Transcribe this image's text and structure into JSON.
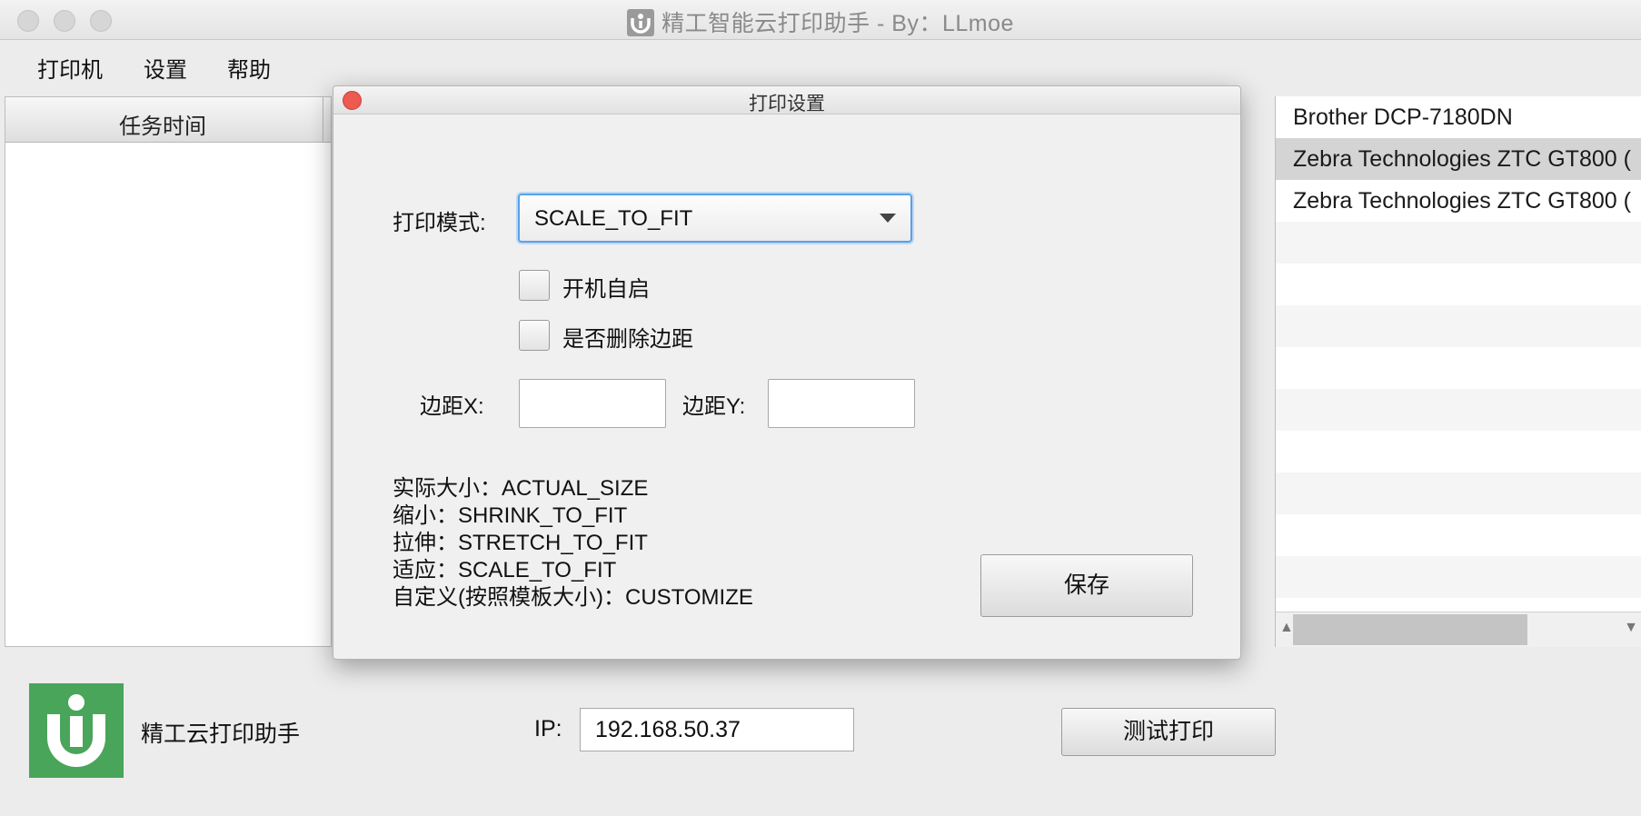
{
  "window": {
    "title": "精工智能云打印助手 - By：LLmoe"
  },
  "menu": {
    "items": [
      "打印机",
      "设置",
      "帮助"
    ]
  },
  "task_table": {
    "columns": [
      "任务时间"
    ]
  },
  "printers": {
    "items": [
      "Brother DCP-7180DN",
      "Zebra Technologies ZTC GT800 (",
      "Zebra Technologies ZTC GT800 ("
    ],
    "selected_index": 1,
    "scroll_arrow_left": "▲",
    "scroll_arrow_right": "▼"
  },
  "bottom": {
    "brand": "精工云打印助手",
    "ip_label": "IP:",
    "ip_value": "192.168.50.37",
    "test_print_label": "测试打印",
    "logo_color": "#49a55a"
  },
  "dialog": {
    "title": "打印设置",
    "print_mode_label": "打印模式:",
    "print_mode_value": "SCALE_TO_FIT",
    "autostart_label": "开机自启",
    "remove_margin_label": "是否删除边距",
    "margin_x_label": "边距X:",
    "margin_y_label": "边距Y:",
    "margin_x_value": "",
    "margin_y_value": "",
    "info_lines": [
      "实际大小：ACTUAL_SIZE",
      "缩小：SHRINK_TO_FIT",
      "拉伸：STRETCH_TO_FIT",
      "适应：SCALE_TO_FIT",
      "自定义(按照模板大小)：CUSTOMIZE"
    ],
    "save_label": "保存",
    "focus_color": "#5aa0e6",
    "close_color": "#ec5a52"
  }
}
